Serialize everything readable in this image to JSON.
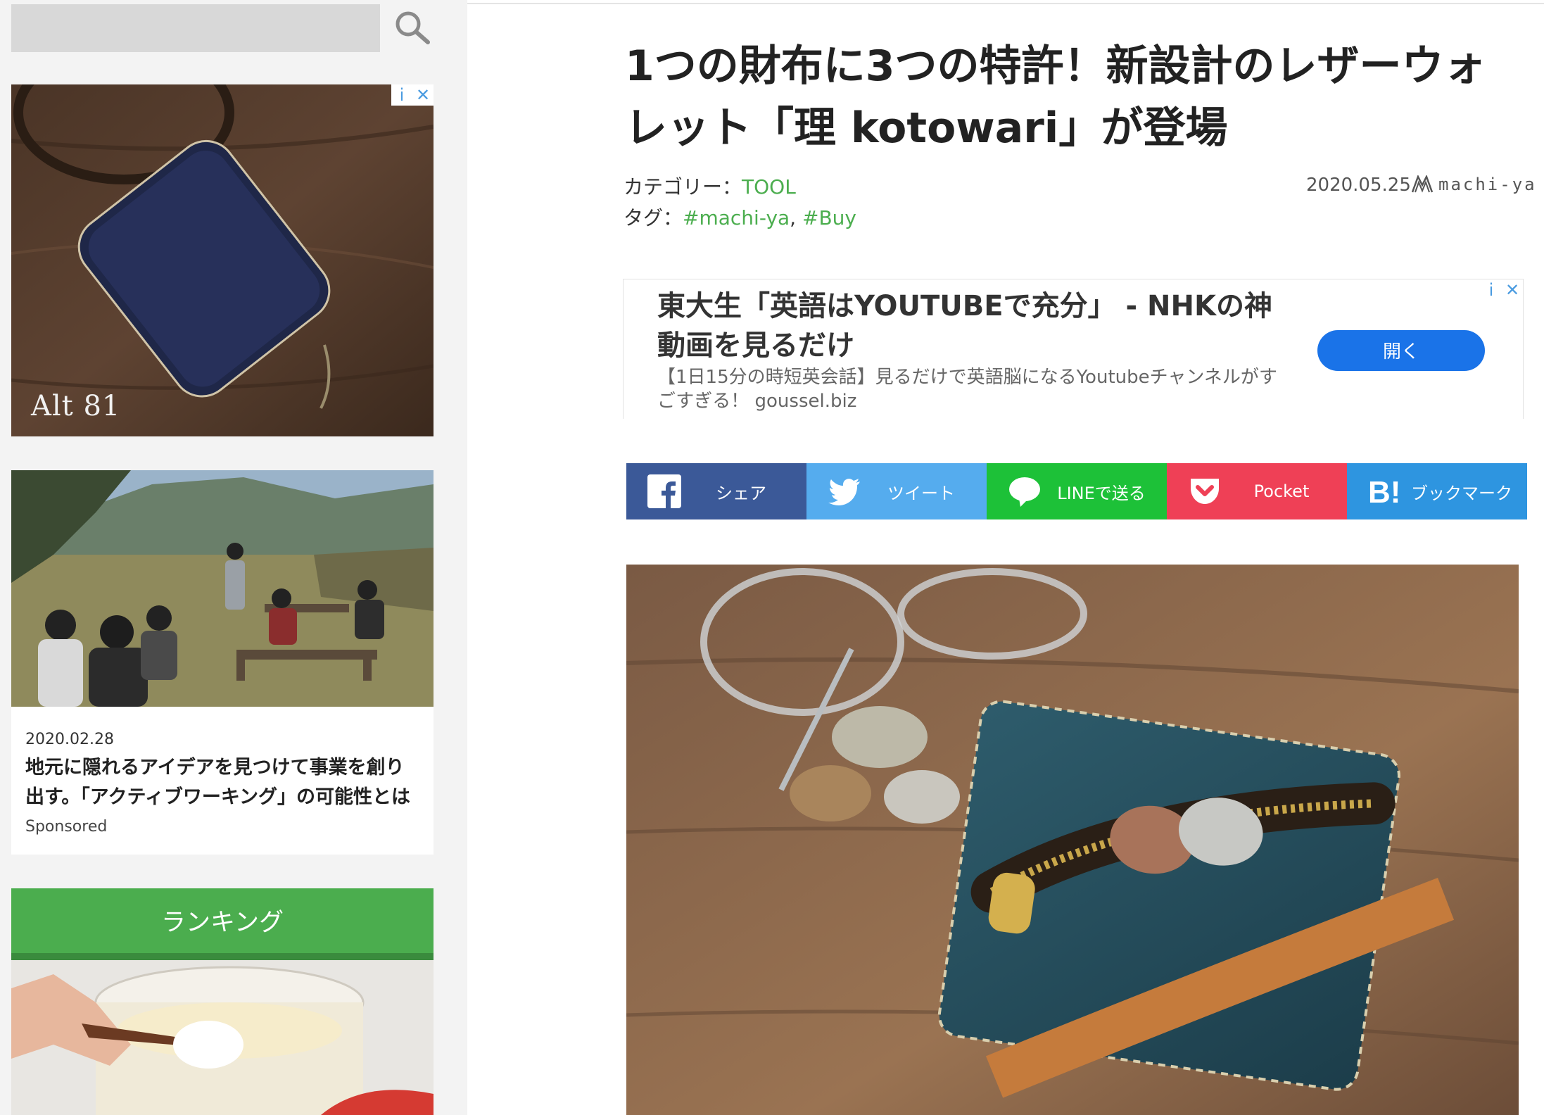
{
  "sidebar": {
    "search_placeholder": "",
    "ad": {
      "brand_text": "Alt 81",
      "info_label": "i",
      "close_label": "✕"
    },
    "card": {
      "date": "2020.02.28",
      "title": "地元に隠れるアイデアを見つけて事業を創り出す。「アクティブワーキング」の可能性とは",
      "sponsored": "Sponsored"
    },
    "ranking_title": "ランキング"
  },
  "article": {
    "headline": "1つの財布に3つの特許！新設計のレザーウォレット「理 kotowari」が登場",
    "category_label": "カテゴリー：",
    "category": "TOOL",
    "tags_label": "タグ：",
    "tags": [
      "#machi-ya",
      "#Buy"
    ],
    "tag_separator": ", ",
    "date": "2020.05.25",
    "brand": "machi-ya"
  },
  "top_ad": {
    "title": "東大生「英語はYOUTUBEで充分」 - NHKの神動画を見るだけ",
    "description": "【1日15分の時短英会話】見るだけで英語脳になるYoutubeチャンネルがすごすぎる！ goussel.biz",
    "button": "開く",
    "info_label": "i",
    "close_label": "✕"
  },
  "share": {
    "facebook": "シェア",
    "twitter": "ツイート",
    "line": "LINEで送る",
    "pocket": "Pocket",
    "hatena": "ブックマーク"
  },
  "colors": {
    "accent_green": "#4cae4f",
    "facebook": "#3b5998",
    "twitter": "#55acee",
    "line": "#1dc138",
    "pocket": "#ef4056",
    "hatena": "#2e95e0",
    "ad_button": "#1a73e8"
  }
}
